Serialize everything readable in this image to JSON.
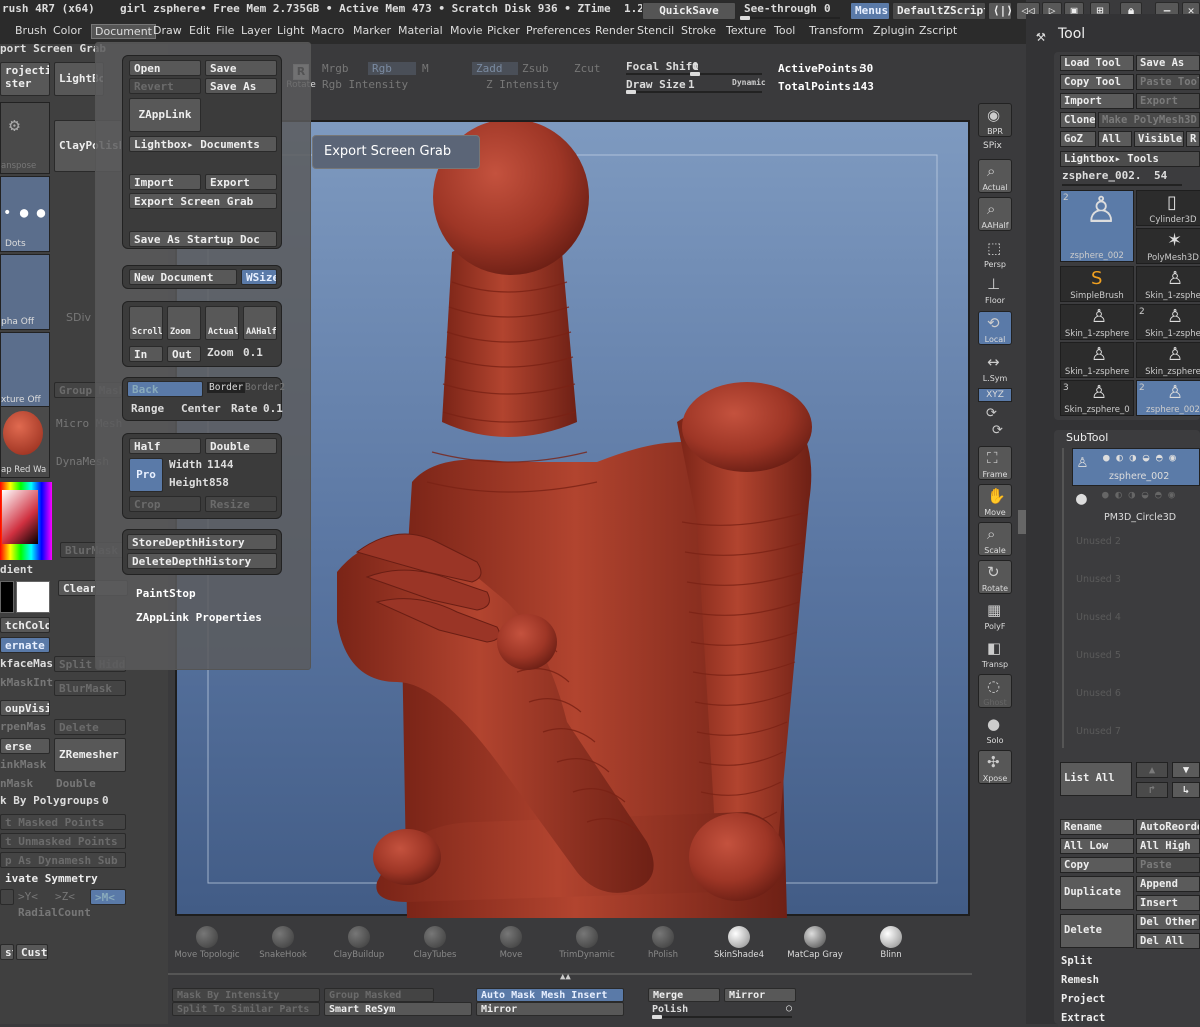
{
  "topbar": {
    "title": "rush 4R7 (x64)",
    "doc_name": "girl zsphere",
    "stats": "• Free Mem 2.735GB • Active Mem 473 • Scratch Disk 936 • ZTime",
    "ztime_value": "1.2",
    "quicksave": "QuickSave",
    "seethrough_label": "See-through",
    "seethrough_value": "0",
    "menus_btn": "Menus",
    "default_zscript": "DefaultZScript"
  },
  "menubar": [
    "Brush",
    "Color",
    "Document",
    "Draw",
    "Edit",
    "File",
    "Layer",
    "Light",
    "Macro",
    "Marker",
    "Material",
    "Movie",
    "Picker",
    "Preferences",
    "Render",
    "Stencil",
    "Stroke",
    "Texture",
    "Tool",
    "Transform",
    "Zplugin",
    "Zscript"
  ],
  "top_controls": {
    "mrgb": "Mrgb",
    "rgb": "Rgb",
    "m": "M",
    "zadd": "Zadd",
    "zsub": "Zsub",
    "zcut": "Zcut",
    "rgb_intensity": "Rgb Intensity",
    "z_intensity": "Z Intensity",
    "focal_shift_label": "Focal Shift",
    "focal_shift_value": "0",
    "draw_size_label": "Draw Size",
    "draw_size_value": "1",
    "dynamic": "Dynamic",
    "active_points_label": "ActivePoints:",
    "active_points_value": "30",
    "total_points_label": "TotalPoints:",
    "total_points_value": "143",
    "rotate": "Rotate"
  },
  "left_panel": {
    "header": "port Screen Grab",
    "projection": "rojection\nster",
    "lightbox": "LightBox",
    "transpose": "anspose",
    "claypolish": "ClayPolish",
    "dots": "Dots",
    "sdiv": "SDiv",
    "alpha_off": "pha Off",
    "group_mask": "Group Mask",
    "texture_off": "xture Off",
    "micro_mesh": "Micro Mesh",
    "dynamesh": "DynaMesh",
    "material": "ap Red Wa",
    "blur_mask": "BlurMask",
    "gradient": "dient",
    "clear": "Clear",
    "switch_color": "tchColor",
    "alternate": "ernate",
    "backface_mask": "kfaceMas",
    "split_hidden": "Split Hidden",
    "mask_int": "kMaskInt",
    "blur_mask2": "BlurMask",
    "group_visible": "oupVisible",
    "sharpen_mask": "rpenMas",
    "delete": "Delete",
    "reverse": "erse",
    "zremesher": "ZRemesher",
    "link_mask": "inkMask",
    "unmask": "nMask",
    "double": "Double",
    "by_polygroups": "k By Polygroups",
    "by_polygroups_value": "0",
    "masked_points": "t Masked Points",
    "unmasked_points": "t Unmasked Points",
    "as_dynamesh": "p As Dynamesh Sub",
    "activate_symmetry": "ivate Symmetry",
    "sym_x": ">X<",
    "sym_y": ">Y<",
    "sym_z": ">Z<",
    "sym_m": ">M<",
    "radial_count": "RadialCount",
    "paintstop": "PaintStop",
    "zapplink_props": "ZAppLink Properties",
    "st": "st",
    "cust": "Cust2"
  },
  "document_popup": {
    "open": "Open",
    "save": "Save",
    "revert": "Revert",
    "save_as": "Save As",
    "zapplink": "ZAppLink",
    "lightbox_docs": "Lightbox▸ Documents",
    "import": "Import",
    "export": "Export",
    "export_screen_grab": "Export Screen Grab",
    "save_startup": "Save As Startup Doc",
    "new_document": "New Document",
    "wsize": "WSize",
    "scroll": "Scroll",
    "zoom": "Zoom",
    "actual": "Actual",
    "aahalf": "AAHalf",
    "in": "In",
    "out": "Out",
    "zoom_label": "Zoom",
    "zoom_value": "0.1",
    "back": "Back",
    "border": "Border",
    "border2": "Border2",
    "range": "Range",
    "center": "Center",
    "rate": "Rate",
    "rate_value": "0.1",
    "half": "Half",
    "double": "Double",
    "pro": "Pro",
    "width_label": "Width",
    "width_value": "1144",
    "height_label": "Height",
    "height_value": "858",
    "crop": "Crop",
    "resize": "Resize",
    "store_depth": "StoreDepthHistory",
    "delete_depth": "DeleteDepthHistory"
  },
  "tooltip": "Export Screen Grab",
  "right_shelf": [
    {
      "label": "BPR",
      "sub": "SPix",
      "icon": "bpr-icon"
    },
    {
      "label": "Actual",
      "icon": "actual-icon"
    },
    {
      "label": "AAHalf",
      "icon": "aahalf-icon"
    },
    {
      "label": "Persp",
      "icon": "persp-icon"
    },
    {
      "label": "Floor",
      "icon": "floor-icon"
    },
    {
      "label": "Local",
      "icon": "local-icon"
    },
    {
      "label": "L.Sym",
      "icon": "lsym-icon"
    },
    {
      "label": "XYZ",
      "icon": "xyz-icon"
    },
    {
      "label": "Frame",
      "icon": "frame-icon"
    },
    {
      "label": "Move",
      "icon": "move-icon"
    },
    {
      "label": "Scale",
      "icon": "scale-icon"
    },
    {
      "label": "Rotate",
      "icon": "rotate-icon"
    },
    {
      "label": "PolyF",
      "icon": "polyf-icon"
    },
    {
      "label": "Transp",
      "icon": "transp-icon"
    },
    {
      "label": "Ghost",
      "icon": "ghost-icon"
    },
    {
      "label": "Solo",
      "icon": "solo-icon"
    },
    {
      "label": "Xpose",
      "icon": "xpose-icon"
    }
  ],
  "tool_panel": {
    "title": "Tool",
    "load_tool": "Load Tool",
    "save_as": "Save As",
    "copy_tool": "Copy Tool",
    "paste_tool": "Paste Tool",
    "import": "Import",
    "export": "Export",
    "clone": "Clone",
    "make_polymesh": "Make PolyMesh3D",
    "goz": "GoZ",
    "all": "All",
    "visible": "Visible",
    "r": "R",
    "lightbox_tools": "Lightbox▸ Tools",
    "current_tool": "zsphere_002.",
    "current_tool_value": "54",
    "tools": [
      {
        "name": "zsphere_002",
        "count": "2",
        "selected": true
      },
      {
        "name": "Cylinder3D",
        "count": "",
        "selected": false
      },
      {
        "name": "PolyMesh3D",
        "count": "",
        "selected": false
      },
      {
        "name": "SimpleBrush",
        "count": "",
        "selected": false
      },
      {
        "name": "Skin_1-zsphe",
        "count": "",
        "selected": false
      },
      {
        "name": "Skin_1-zsphere",
        "count": "",
        "selected": false
      },
      {
        "name": "Skin_1-zsphe",
        "count": "2",
        "selected": false
      },
      {
        "name": "Skin_1-zsphere",
        "count": "",
        "selected": false
      },
      {
        "name": "Skin_zsphere",
        "count": "",
        "selected": false
      },
      {
        "name": "Skin_zsphere_0",
        "count": "3",
        "selected": false
      },
      {
        "name": "zsphere_002",
        "count": "2",
        "selected": true
      }
    ],
    "subtool_title": "SubTool",
    "subtools": [
      {
        "name": "zsphere_002",
        "selected": true
      },
      {
        "name": "PM3D_Circle3D",
        "selected": false
      },
      {
        "name": "Unused 2",
        "selected": false
      },
      {
        "name": "Unused 3",
        "selected": false
      },
      {
        "name": "Unused 4",
        "selected": false
      },
      {
        "name": "Unused 5",
        "selected": false
      },
      {
        "name": "Unused 6",
        "selected": false
      },
      {
        "name": "Unused 7",
        "selected": false
      }
    ],
    "list_all": "List All",
    "rename": "Rename",
    "autoreorder": "AutoReorder",
    "all_low": "All Low",
    "all_high": "All High",
    "copy": "Copy",
    "paste": "Paste",
    "duplicate": "Duplicate",
    "append": "Append",
    "insert": "Insert",
    "delete": "Delete",
    "del_other": "Del Other",
    "del_all": "Del All",
    "split": "Split",
    "remesh": "Remesh",
    "project": "Project",
    "extract": "Extract"
  },
  "bottom_brushes": [
    {
      "name": "Move Topologic",
      "active": false
    },
    {
      "name": "SnakeHook",
      "active": false
    },
    {
      "name": "ClayBuildup",
      "active": false
    },
    {
      "name": "ClayTubes",
      "active": false
    },
    {
      "name": "Move",
      "active": false
    },
    {
      "name": "TrimDynamic",
      "active": false
    },
    {
      "name": "hPolish",
      "active": false
    },
    {
      "name": "SkinShade4",
      "active": true
    },
    {
      "name": "MatCap Gray",
      "active": true
    },
    {
      "name": "Blinn",
      "active": true
    }
  ],
  "bottom_buttons": {
    "mask_by_intensity": "Mask By Intensity",
    "group_masked": "Group Masked",
    "auto_mask_mesh_insert": "Auto Mask Mesh Insert",
    "merge": "Merge",
    "mirror": "Mirror",
    "split_similar": "Split To Similar Parts",
    "smart_resym": "Smart ReSym",
    "mirror2": "Mirror",
    "polish": "Polish"
  },
  "colors": {
    "accent_blue": "#5a7aa8",
    "model_red": "#a33a2a",
    "canvas_top": "#7e9ac0",
    "canvas_bottom": "#425c86"
  }
}
